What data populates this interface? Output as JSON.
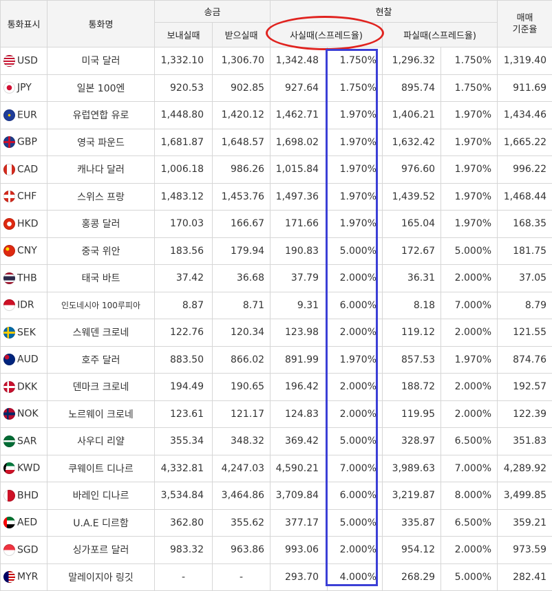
{
  "headers": {
    "code": "통화표시",
    "name": "통화명",
    "transfer": "송금",
    "cash": "현찰",
    "base": "매매\n기준율",
    "send": "보내실때",
    "receive": "받으실때",
    "buy": "사실때(스프레드율)",
    "sell": "파실때(스프레드율)"
  },
  "colors": {
    "circle_highlight": "#e0231f",
    "column_highlight": "#3b3fd6"
  },
  "rows": [
    {
      "code": "USD",
      "name": "미국 달러",
      "flag": "us-flag-icon",
      "send": "1,332.10",
      "receive": "1,306.70",
      "buy": "1,342.48",
      "buy_spread": "1.750%",
      "sell": "1,296.32",
      "sell_spread": "1.750%",
      "base": "1,319.40"
    },
    {
      "code": "JPY",
      "name": "일본 100엔",
      "flag": "jp-flag-icon",
      "send": "920.53",
      "receive": "902.85",
      "buy": "927.64",
      "buy_spread": "1.750%",
      "sell": "895.74",
      "sell_spread": "1.750%",
      "base": "911.69"
    },
    {
      "code": "EUR",
      "name": "유럽연합 유로",
      "flag": "eu-flag-icon",
      "send": "1,448.80",
      "receive": "1,420.12",
      "buy": "1,462.71",
      "buy_spread": "1.970%",
      "sell": "1,406.21",
      "sell_spread": "1.970%",
      "base": "1,434.46"
    },
    {
      "code": "GBP",
      "name": "영국 파운드",
      "flag": "gb-flag-icon",
      "send": "1,681.87",
      "receive": "1,648.57",
      "buy": "1,698.02",
      "buy_spread": "1.970%",
      "sell": "1,632.42",
      "sell_spread": "1.970%",
      "base": "1,665.22"
    },
    {
      "code": "CAD",
      "name": "캐나다 달러",
      "flag": "ca-flag-icon",
      "send": "1,006.18",
      "receive": "986.26",
      "buy": "1,015.84",
      "buy_spread": "1.970%",
      "sell": "976.60",
      "sell_spread": "1.970%",
      "base": "996.22"
    },
    {
      "code": "CHF",
      "name": "스위스 프랑",
      "flag": "ch-flag-icon",
      "send": "1,483.12",
      "receive": "1,453.76",
      "buy": "1,497.36",
      "buy_spread": "1.970%",
      "sell": "1,439.52",
      "sell_spread": "1.970%",
      "base": "1,468.44"
    },
    {
      "code": "HKD",
      "name": "홍콩 달러",
      "flag": "hk-flag-icon",
      "send": "170.03",
      "receive": "166.67",
      "buy": "171.66",
      "buy_spread": "1.970%",
      "sell": "165.04",
      "sell_spread": "1.970%",
      "base": "168.35"
    },
    {
      "code": "CNY",
      "name": "중국 위안",
      "flag": "cn-flag-icon",
      "send": "183.56",
      "receive": "179.94",
      "buy": "190.83",
      "buy_spread": "5.000%",
      "sell": "172.67",
      "sell_spread": "5.000%",
      "base": "181.75"
    },
    {
      "code": "THB",
      "name": "태국 바트",
      "flag": "th-flag-icon",
      "send": "37.42",
      "receive": "36.68",
      "buy": "37.79",
      "buy_spread": "2.000%",
      "sell": "36.31",
      "sell_spread": "2.000%",
      "base": "37.05"
    },
    {
      "code": "IDR",
      "name": "인도네시아 100루피아",
      "flag": "id-flag-icon",
      "send": "8.87",
      "receive": "8.71",
      "buy": "9.31",
      "buy_spread": "6.000%",
      "sell": "8.18",
      "sell_spread": "7.000%",
      "base": "8.79"
    },
    {
      "code": "SEK",
      "name": "스웨덴 크로네",
      "flag": "se-flag-icon",
      "send": "122.76",
      "receive": "120.34",
      "buy": "123.98",
      "buy_spread": "2.000%",
      "sell": "119.12",
      "sell_spread": "2.000%",
      "base": "121.55"
    },
    {
      "code": "AUD",
      "name": "호주 달러",
      "flag": "au-flag-icon",
      "send": "883.50",
      "receive": "866.02",
      "buy": "891.99",
      "buy_spread": "1.970%",
      "sell": "857.53",
      "sell_spread": "1.970%",
      "base": "874.76"
    },
    {
      "code": "DKK",
      "name": "덴마크 크로네",
      "flag": "dk-flag-icon",
      "send": "194.49",
      "receive": "190.65",
      "buy": "196.42",
      "buy_spread": "2.000%",
      "sell": "188.72",
      "sell_spread": "2.000%",
      "base": "192.57"
    },
    {
      "code": "NOK",
      "name": "노르웨이 크로네",
      "flag": "no-flag-icon",
      "send": "123.61",
      "receive": "121.17",
      "buy": "124.83",
      "buy_spread": "2.000%",
      "sell": "119.95",
      "sell_spread": "2.000%",
      "base": "122.39"
    },
    {
      "code": "SAR",
      "name": "사우디 리얄",
      "flag": "sa-flag-icon",
      "send": "355.34",
      "receive": "348.32",
      "buy": "369.42",
      "buy_spread": "5.000%",
      "sell": "328.97",
      "sell_spread": "6.500%",
      "base": "351.83"
    },
    {
      "code": "KWD",
      "name": "쿠웨이트 디나르",
      "flag": "kw-flag-icon",
      "send": "4,332.81",
      "receive": "4,247.03",
      "buy": "4,590.21",
      "buy_spread": "7.000%",
      "sell": "3,989.63",
      "sell_spread": "7.000%",
      "base": "4,289.92"
    },
    {
      "code": "BHD",
      "name": "바레인 디나르",
      "flag": "bh-flag-icon",
      "send": "3,534.84",
      "receive": "3,464.86",
      "buy": "3,709.84",
      "buy_spread": "6.000%",
      "sell": "3,219.87",
      "sell_spread": "8.000%",
      "base": "3,499.85"
    },
    {
      "code": "AED",
      "name": "U.A.E 디르함",
      "flag": "ae-flag-icon",
      "send": "362.80",
      "receive": "355.62",
      "buy": "377.17",
      "buy_spread": "5.000%",
      "sell": "335.87",
      "sell_spread": "6.500%",
      "base": "359.21"
    },
    {
      "code": "SGD",
      "name": "싱가포르 달러",
      "flag": "sg-flag-icon",
      "send": "983.32",
      "receive": "963.86",
      "buy": "993.06",
      "buy_spread": "2.000%",
      "sell": "954.12",
      "sell_spread": "2.000%",
      "base": "973.59"
    },
    {
      "code": "MYR",
      "name": "말레이지아 링깃",
      "flag": "my-flag-icon",
      "send": "-",
      "receive": "-",
      "buy": "293.70",
      "buy_spread": "4.000%",
      "sell": "268.29",
      "sell_spread": "5.000%",
      "base": "282.41"
    }
  ]
}
